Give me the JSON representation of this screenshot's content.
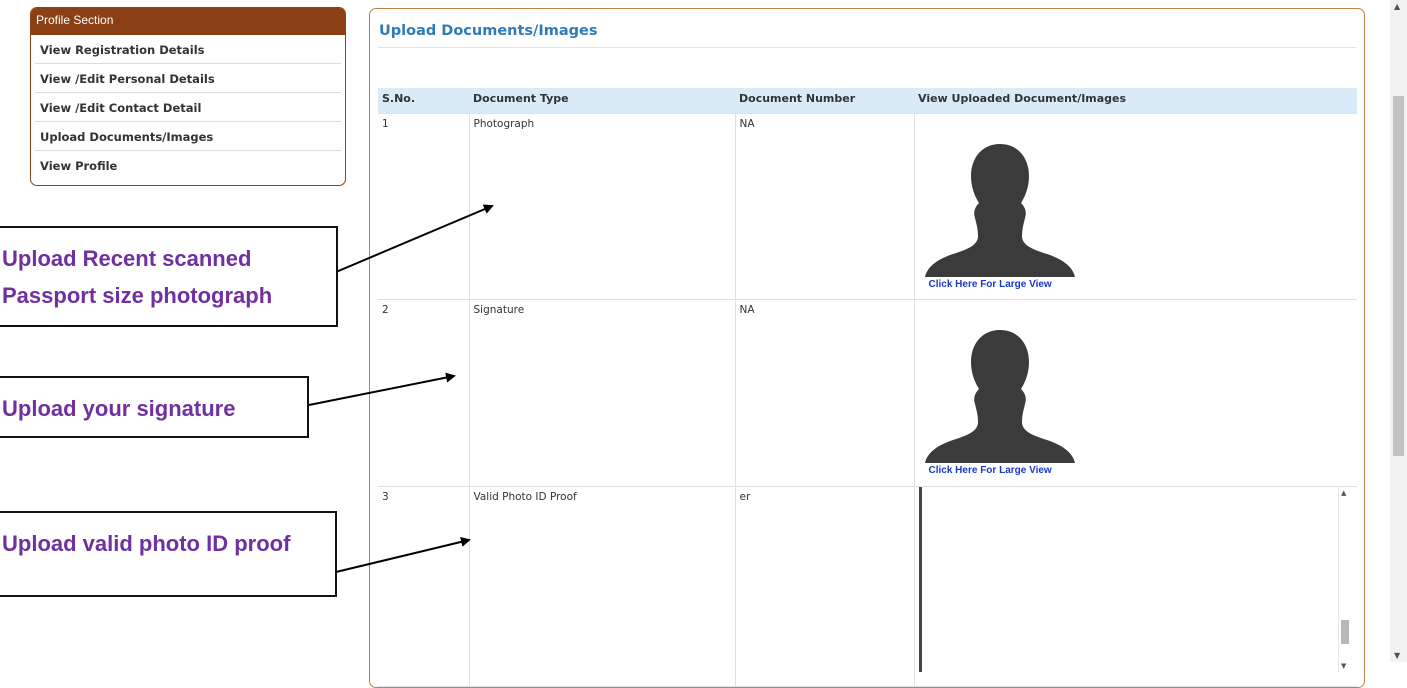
{
  "sidebar": {
    "header": "Profile Section",
    "items": [
      {
        "label": "View Registration Details"
      },
      {
        "label": "View /Edit Personal Details"
      },
      {
        "label": "View /Edit Contact Detail"
      },
      {
        "label": "Upload Documents/Images"
      },
      {
        "label": "View Profile"
      }
    ]
  },
  "main": {
    "title": "Upload Documents/Images",
    "table": {
      "headers": [
        "S.No.",
        "Document Type",
        "Document Number",
        "View Uploaded Document/Images"
      ],
      "rows": [
        {
          "sno": "1",
          "type": "Photograph",
          "number": "NA",
          "link": "Click Here For Large View"
        },
        {
          "sno": "2",
          "type": "Signature",
          "number": "NA",
          "link": "Click Here For Large View"
        },
        {
          "sno": "3",
          "type": "Valid Photo ID Proof",
          "number": "er",
          "link": ""
        }
      ]
    }
  },
  "callouts": {
    "photo": "Upload Recent scanned Passport size photograph",
    "signature": "Upload your signature",
    "id_proof": "Upload valid photo ID proof"
  },
  "colors": {
    "accent": "#8b3f14",
    "title_blue": "#2d7bb9",
    "callout_text": "#7030a0",
    "link_blue": "#1a38c9",
    "table_header_bg": "#d9ebf7"
  },
  "icons": {
    "avatar": "person-silhouette-icon",
    "scroll_up": "scroll-up-arrow-icon",
    "scroll_down": "scroll-down-arrow-icon"
  }
}
